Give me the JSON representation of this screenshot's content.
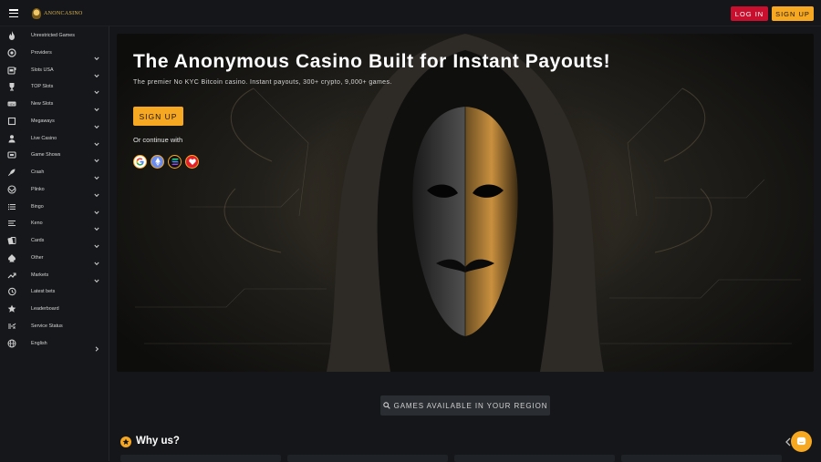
{
  "header": {
    "logo_text": "ANONCASINO",
    "login_label": "LOG IN",
    "signup_label": "SIGN UP"
  },
  "sidebar": {
    "items": [
      {
        "label": "Unrestricted Games",
        "icon": "flame-icon",
        "has_chevron": false
      },
      {
        "label": "Providers",
        "icon": "chip-icon",
        "has_chevron": true
      },
      {
        "label": "Slots USA",
        "icon": "slot-machine-icon",
        "has_chevron": true
      },
      {
        "label": "TOP Slots",
        "icon": "trophy-icon",
        "has_chevron": true
      },
      {
        "label": "New Slots",
        "icon": "new-badge-icon",
        "has_chevron": true
      },
      {
        "label": "Megaways",
        "icon": "square-icon",
        "has_chevron": true
      },
      {
        "label": "Live Casino",
        "icon": "dealer-icon",
        "has_chevron": true
      },
      {
        "label": "Game Shows",
        "icon": "tv-icon",
        "has_chevron": true
      },
      {
        "label": "Crash",
        "icon": "rocket-icon",
        "has_chevron": true
      },
      {
        "label": "Plinko",
        "icon": "plinko-icon",
        "has_chevron": true
      },
      {
        "label": "Bingo",
        "icon": "list-icon",
        "has_chevron": true
      },
      {
        "label": "Keno",
        "icon": "keno-icon",
        "has_chevron": true
      },
      {
        "label": "Cards",
        "icon": "cards-icon",
        "has_chevron": true
      },
      {
        "label": "Other",
        "icon": "spade-icon",
        "has_chevron": true
      },
      {
        "label": "Markets",
        "icon": "trend-up-icon",
        "has_chevron": true
      },
      {
        "label": "Latest bets",
        "icon": "history-icon",
        "has_chevron": false
      },
      {
        "label": "Leaderboard",
        "icon": "star-icon",
        "has_chevron": false
      },
      {
        "label": "Service Status",
        "icon": "status-icon",
        "has_chevron": false
      },
      {
        "label": "English",
        "icon": "globe-icon",
        "has_chevron": false,
        "chevron_right": true
      }
    ]
  },
  "hero": {
    "title": "The Anonymous Casino Built for Instant Payouts!",
    "subtitle": "The premier No KYC Bitcoin casino. Instant payouts, 300+ crypto, 9,000+ games.",
    "signup_label": "SIGN UP",
    "continue_label": "Or continue with",
    "social": [
      {
        "name": "google-icon",
        "color": "#ffffff"
      },
      {
        "name": "ethereum-icon",
        "color": "#6b8cef"
      },
      {
        "name": "solana-icon",
        "color": "#111111"
      },
      {
        "name": "heart-wallet-icon",
        "color": "#e3202a"
      }
    ]
  },
  "region_button": {
    "label": "GAMES AVAILABLE IN YOUR REGION",
    "icon": "search-icon"
  },
  "why_us": {
    "title": "Why us?",
    "icon": "star-badge-icon"
  },
  "colors": {
    "accent": "#f7a823",
    "login_red": "#c8102e",
    "background": "#141619"
  }
}
